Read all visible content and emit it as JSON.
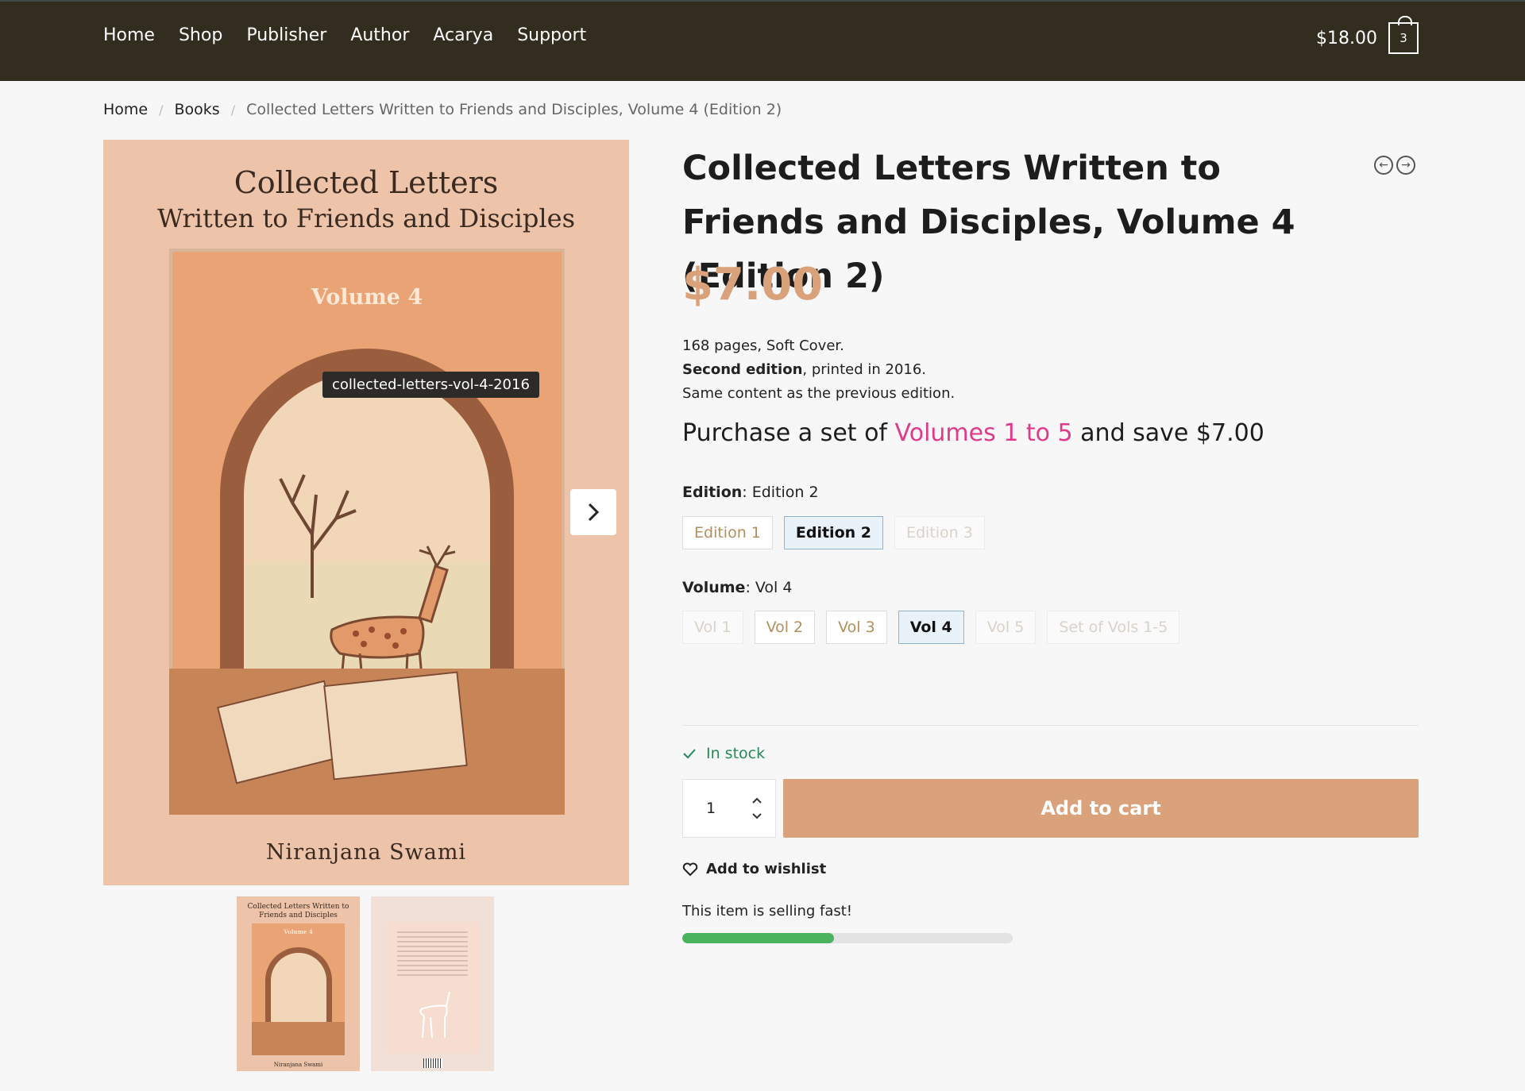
{
  "header": {
    "nav": [
      "Home",
      "Shop",
      "Publisher",
      "Author",
      "Acarya",
      "Support"
    ],
    "cart_total": "$18.00",
    "cart_count": "3"
  },
  "breadcrumb": {
    "items": [
      "Home",
      "Books"
    ],
    "current": "Collected Letters Written to Friends and Disciples, Volume 4 (Edition 2)",
    "separator": "/"
  },
  "gallery": {
    "cover_title_line1": "Collected Letters",
    "cover_title_line2": "Written to Friends and Disciples",
    "cover_volume": "Volume 4",
    "cover_author": "Niranjana Swami",
    "tooltip": "collected-letters-vol-4-2016",
    "thumb_title": "Collected Letters Written to Friends and Disciples",
    "thumb_volume": "Volume 4",
    "thumb_author": "Niranjana Swami"
  },
  "product": {
    "title": "Collected Letters Written to Friends and Disciples, Volume 4 (Edition 2)",
    "price": "$7.00",
    "desc_line1": "168 pages, Soft Cover.",
    "desc_edition_bold": "Second edition",
    "desc_edition_rest": ", printed in 2016.",
    "desc_line3": "Same content as the previous edition.",
    "promo_prefix": "Purchase a set of ",
    "promo_link": "Volumes 1 to 5",
    "promo_suffix": " and save $7.00"
  },
  "attributes": {
    "edition_label": "Edition",
    "edition_selected": "Edition 2",
    "editions": [
      "Edition 1",
      "Edition 2",
      "Edition 3"
    ],
    "volume_label": "Volume",
    "volume_selected": "Vol 4",
    "volumes": [
      "Vol 1",
      "Vol 2",
      "Vol 3",
      "Vol 4",
      "Vol 5",
      "Set of Vols 1-5"
    ]
  },
  "purchase": {
    "stock": "In stock",
    "quantity": "1",
    "add_to_cart": "Add to cart",
    "wishlist": "Add to wishlist",
    "selling_fast": "This item is selling fast!",
    "selling_progress": 0.46
  },
  "colors": {
    "header_bg": "#322d1f",
    "accent": "#d9a27a",
    "promo_link": "#e03a8a",
    "stock_green": "#248a5a",
    "progress_green": "#4bb25e"
  },
  "icons": [
    "shopping-bag-icon",
    "chevron-right-icon",
    "arrow-left-circle-icon",
    "arrow-right-circle-icon",
    "check-icon",
    "chevron-up-icon",
    "chevron-down-icon",
    "heart-icon"
  ]
}
